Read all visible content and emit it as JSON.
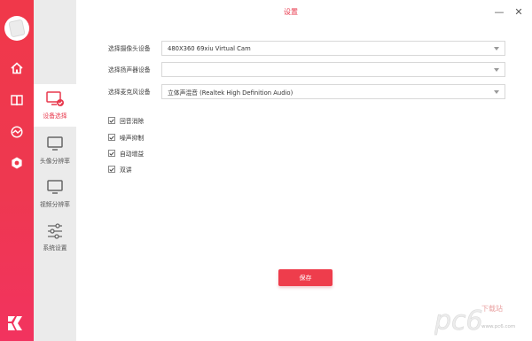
{
  "window": {
    "title": "设置",
    "minimize_label": "—",
    "close_label": "✕"
  },
  "rail": {
    "icons": [
      "home-icon",
      "book-icon",
      "analytics-icon",
      "settings-icon"
    ],
    "logo": "app-logo",
    "accent": "#f0384a"
  },
  "sidebar": {
    "items": [
      {
        "label": "设备选择",
        "icon": "monitor-check-icon",
        "active": true
      },
      {
        "label": "头像分辨率",
        "icon": "monitor-icon",
        "active": false
      },
      {
        "label": "视频分辨率",
        "icon": "monitor-icon",
        "active": false
      },
      {
        "label": "系统设置",
        "icon": "sliders-icon",
        "active": false
      }
    ]
  },
  "devices": {
    "camera": {
      "label": "选择摄像头设备",
      "value": "480X360 69xiu Virtual Cam"
    },
    "speaker": {
      "label": "选择扬声器设备",
      "value": ""
    },
    "microphone": {
      "label": "选择麦克风设备",
      "value": "立体声混音 (Realtek High Definition Audio)"
    }
  },
  "options": [
    {
      "label": "回音消除",
      "checked": true
    },
    {
      "label": "噪声抑制",
      "checked": true
    },
    {
      "label": "自动增益",
      "checked": true
    },
    {
      "label": "双讲",
      "checked": true
    }
  ],
  "actions": {
    "save_label": "保存"
  },
  "watermark": {
    "brand": "pc6",
    "text": "下载站",
    "url": "www.pc6.com"
  }
}
